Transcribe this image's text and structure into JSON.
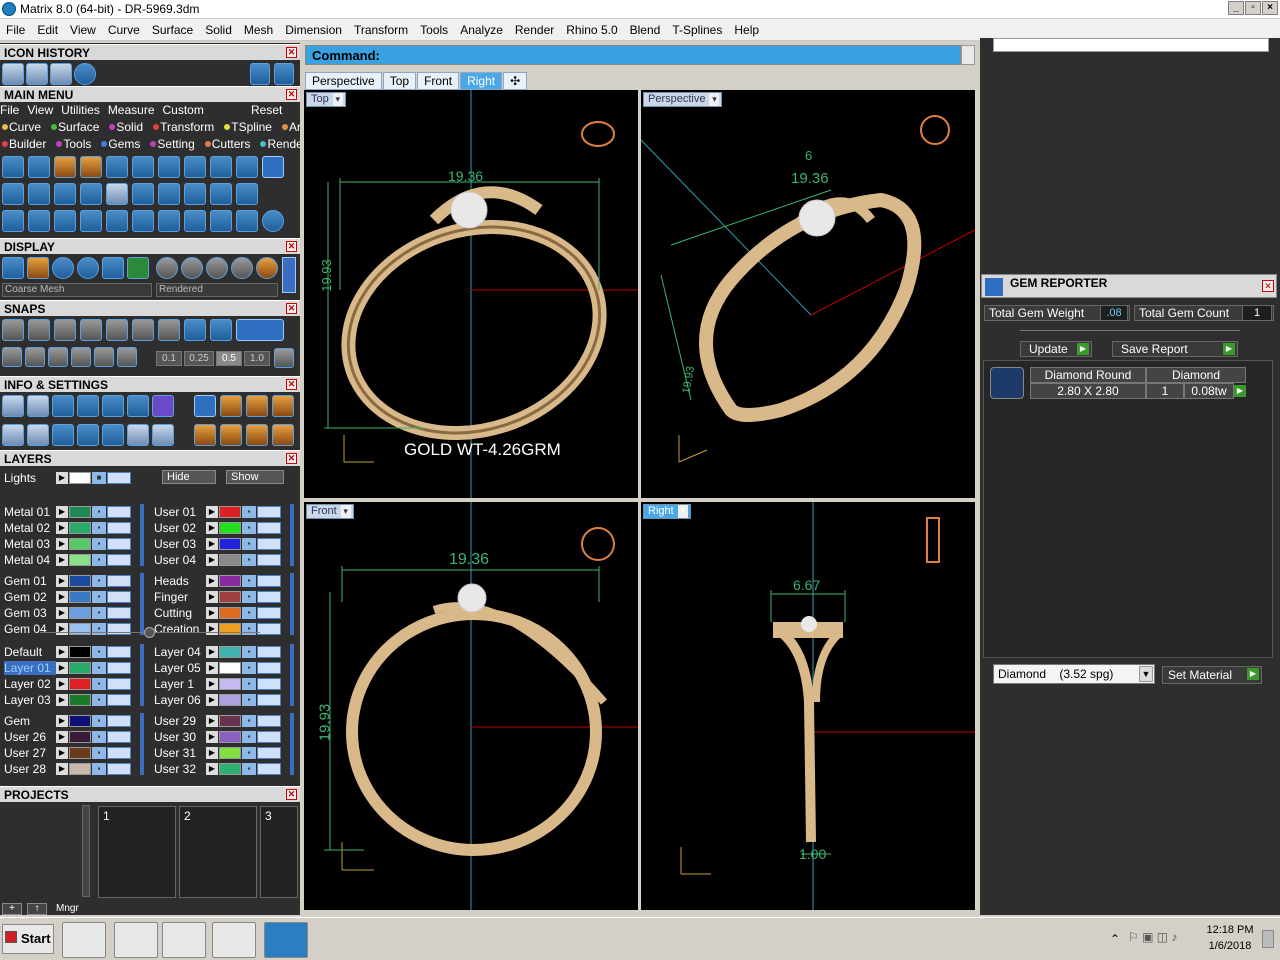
{
  "window": {
    "title": "Matrix 8.0 (64-bit) - DR-5969.3dm"
  },
  "menu": [
    "File",
    "Edit",
    "View",
    "Curve",
    "Surface",
    "Solid",
    "Mesh",
    "Dimension",
    "Transform",
    "Tools",
    "Analyze",
    "Render",
    "Rhino 5.0",
    "Blend",
    "T-Splines",
    "Help"
  ],
  "left": {
    "icon_history": "ICON HISTORY",
    "main_menu": "MAIN MENU",
    "main_menu_items": [
      "File",
      "View",
      "Utilities",
      "Measure",
      "Custom"
    ],
    "reset": "Reset",
    "categories_row1": [
      "Curve",
      "Surface",
      "Solid",
      "Transform",
      "TSpline",
      "Art"
    ],
    "categories_row2": [
      "Builder",
      "Tools",
      "Gems",
      "Setting",
      "Cutters",
      "Render"
    ],
    "display": "DISPLAY",
    "mesh_mode": "Coarse Mesh",
    "render_mode": "Rendered",
    "snaps": "SNAPS",
    "snap_values": [
      "0.1",
      "0.25",
      "0.5",
      "1.0"
    ],
    "info_settings": "INFO & SETTINGS",
    "layers": "LAYERS",
    "lights": "Lights",
    "hide": "Hide",
    "show": "Show",
    "layers_left_a": [
      "Metal 01",
      "Metal 02",
      "Metal 03",
      "Metal 04"
    ],
    "layers_right_a": [
      "User 01",
      "User 02",
      "User 03",
      "User 04"
    ],
    "layers_left_b": [
      "Gem 01",
      "Gem 02",
      "Gem 03",
      "Gem 04"
    ],
    "layers_right_b": [
      "Heads",
      "Finger",
      "Cutting",
      "Creation"
    ],
    "layers_left_c": [
      "Default",
      "Layer 01",
      "Layer 02",
      "Layer 03"
    ],
    "layers_right_c": [
      "Layer 04",
      "Layer 05",
      "Layer 1",
      "Layer 06"
    ],
    "layers_left_d": [
      "Gem",
      "User 26",
      "User 27",
      "User 28"
    ],
    "layers_right_d": [
      "User 29",
      "User 30",
      "User 31",
      "User 32"
    ],
    "projects": "PROJECTS",
    "project_slots": [
      "1",
      "2",
      "3"
    ],
    "mngr": "Mngr"
  },
  "command": {
    "label": "Command:"
  },
  "tabs": [
    "Perspective",
    "Top",
    "Front",
    "Right"
  ],
  "viewports": {
    "top": {
      "label": "Top",
      "dim_w": "19.36",
      "dim_h": "19.93",
      "note": "GOLD WT-4.26GRM"
    },
    "perspective": {
      "label": "Perspective",
      "dim_w": "19.36",
      "dim_s": "6",
      "dim_h": "19.93"
    },
    "front": {
      "label": "Front",
      "dim_w": "19.36",
      "dim_h": "19.93"
    },
    "right": {
      "label": "Right",
      "dim_w": "6.67",
      "dim_b": "1.00"
    }
  },
  "gem_reporter": {
    "title": "GEM REPORTER",
    "weight_label": "Total Gem Weight",
    "weight_value": ".08",
    "count_label": "Total Gem Count",
    "count_value": "1",
    "update": "Update",
    "save_report": "Save Report",
    "row": {
      "shape": "Diamond Round",
      "size": "2.80 X 2.80",
      "material": "Diamond",
      "qty": "1",
      "tw": "0.08tw"
    },
    "material_select": "Diamond    (3.52 spg)",
    "set_material": "Set Material"
  },
  "taskbar": {
    "start": "Start",
    "time": "12:18 PM",
    "date": "1/6/2018"
  },
  "colors": {
    "accent": "#3aa0e0",
    "gold": "#d9b88a",
    "dim": "#3cb371",
    "axis_red": "#c00000",
    "axis_cyan": "#2aa0b0"
  }
}
